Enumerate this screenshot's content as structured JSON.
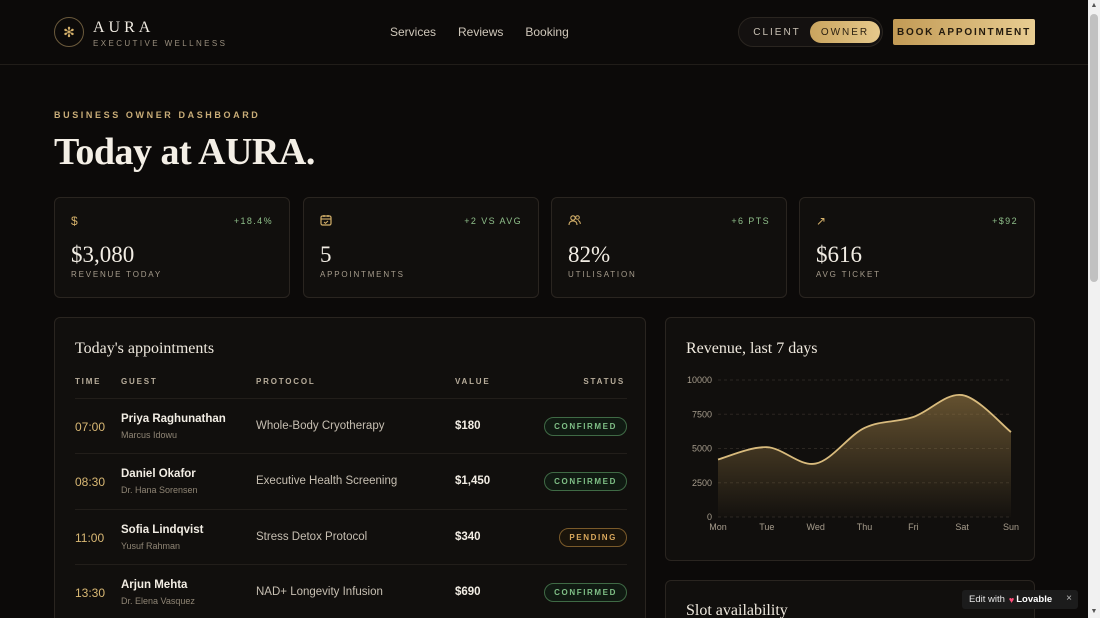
{
  "brand": {
    "name": "AURA",
    "tagline": "EXECUTIVE WELLNESS",
    "mark_icon": "sparkle-icon"
  },
  "nav": [
    "Services",
    "Reviews",
    "Booking"
  ],
  "mode": {
    "client": "CLIENT",
    "owner": "OWNER",
    "active": "owner"
  },
  "book_button": "BOOK APPOINTMENT",
  "eyebrow": "BUSINESS OWNER DASHBOARD",
  "title": "Today at AURA.",
  "kpis": [
    {
      "icon": "dollar-icon",
      "glyph": "$",
      "delta": "+18.4%",
      "value": "$3,080",
      "label": "REVENUE TODAY"
    },
    {
      "icon": "calendar-icon",
      "glyph": "▣",
      "delta": "+2 VS AVG",
      "value": "5",
      "label": "APPOINTMENTS"
    },
    {
      "icon": "users-icon",
      "glyph": "⚇",
      "delta": "+6 PTS",
      "value": "82%",
      "label": "UTILISATION"
    },
    {
      "icon": "arrow-up-right-icon",
      "glyph": "↗",
      "delta": "+$92",
      "value": "$616",
      "label": "AVG TICKET"
    }
  ],
  "appointments": {
    "title": "Today's appointments",
    "columns": {
      "time": "TIME",
      "guest": "GUEST",
      "protocol": "PROTOCOL",
      "value": "VALUE",
      "status": "STATUS"
    },
    "rows": [
      {
        "time": "07:00",
        "guest": "Priya Raghunathan",
        "host": "Marcus Idowu",
        "protocol": "Whole-Body Cryotherapy",
        "value": "$180",
        "status": "CONFIRMED",
        "kind": "confirmed"
      },
      {
        "time": "08:30",
        "guest": "Daniel Okafor",
        "host": "Dr. Hana Sorensen",
        "protocol": "Executive Health Screening",
        "value": "$1,450",
        "status": "CONFIRMED",
        "kind": "confirmed"
      },
      {
        "time": "11:00",
        "guest": "Sofia Lindqvist",
        "host": "Yusuf Rahman",
        "protocol": "Stress Detox Protocol",
        "value": "$340",
        "status": "PENDING",
        "kind": "pending"
      },
      {
        "time": "13:30",
        "guest": "Arjun Mehta",
        "host": "Dr. Elena Vasquez",
        "protocol": "NAD+ Longevity Infusion",
        "value": "$690",
        "status": "CONFIRMED",
        "kind": "confirmed"
      }
    ]
  },
  "slot_title": "Slot availability",
  "lovable": {
    "prefix": "Edit with",
    "brand": "Lovable",
    "close": "×"
  },
  "colors": {
    "accent": "#d4b06a",
    "background": "#0c0a09",
    "positive": "#8fbf8a",
    "pending": "#d9a85c"
  },
  "chart_data": {
    "type": "area",
    "title": "Revenue, last 7 days",
    "categories": [
      "Mon",
      "Tue",
      "Wed",
      "Thu",
      "Fri",
      "Sat",
      "Sun"
    ],
    "values": [
      4200,
      5100,
      3900,
      6500,
      7300,
      8900,
      6200
    ],
    "yticks": [
      0,
      2500,
      5000,
      7500,
      10000
    ],
    "ylim": [
      0,
      10000
    ],
    "xlabel": "",
    "ylabel": "",
    "grid": true
  }
}
